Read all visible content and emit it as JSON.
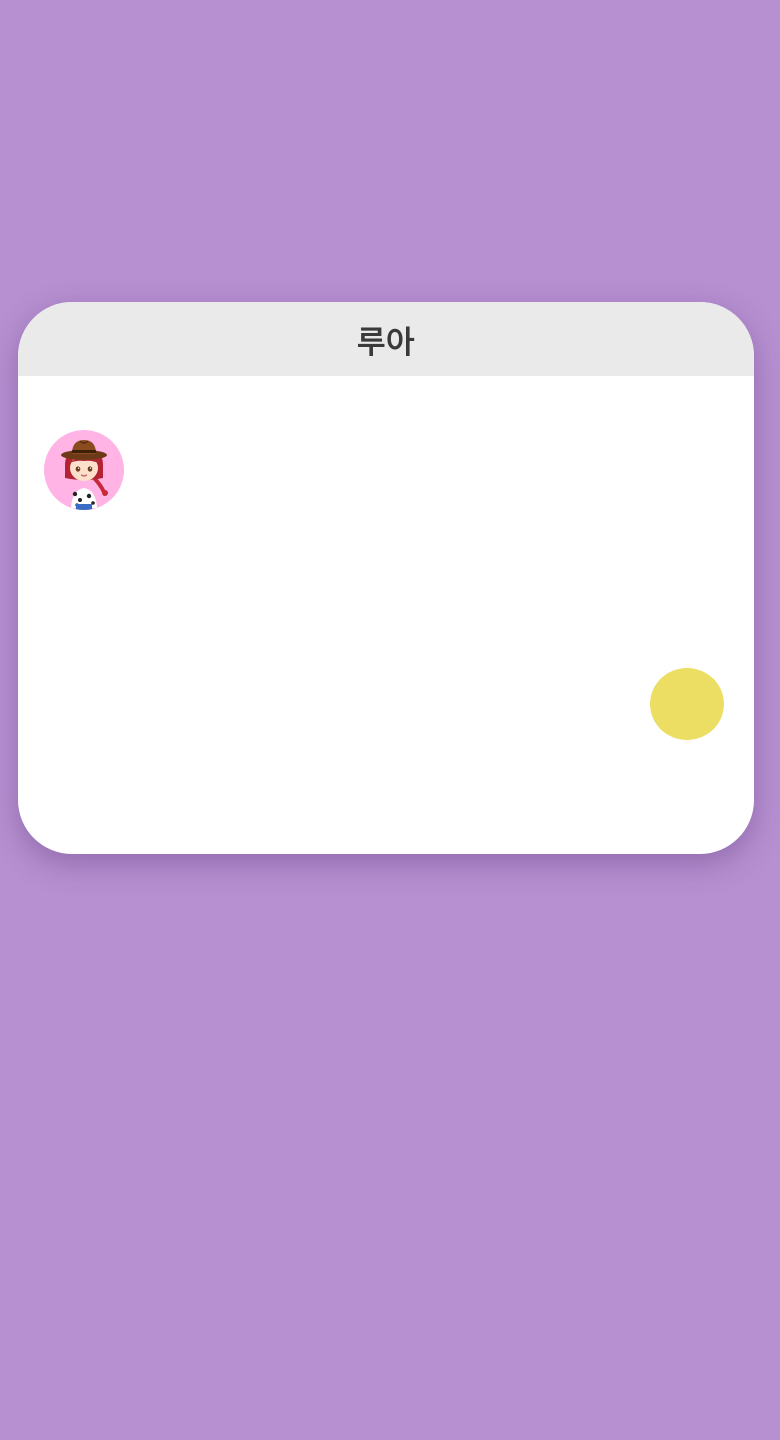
{
  "background_color": "#b690d1",
  "card": {
    "title": "루아",
    "header_color": "#eaeaea",
    "avatar": {
      "icon": "cowgirl-avatar-icon",
      "background_color": "#ffb4e5"
    },
    "indicator": {
      "icon": "yellow-circle",
      "color": "#ebde62"
    }
  }
}
